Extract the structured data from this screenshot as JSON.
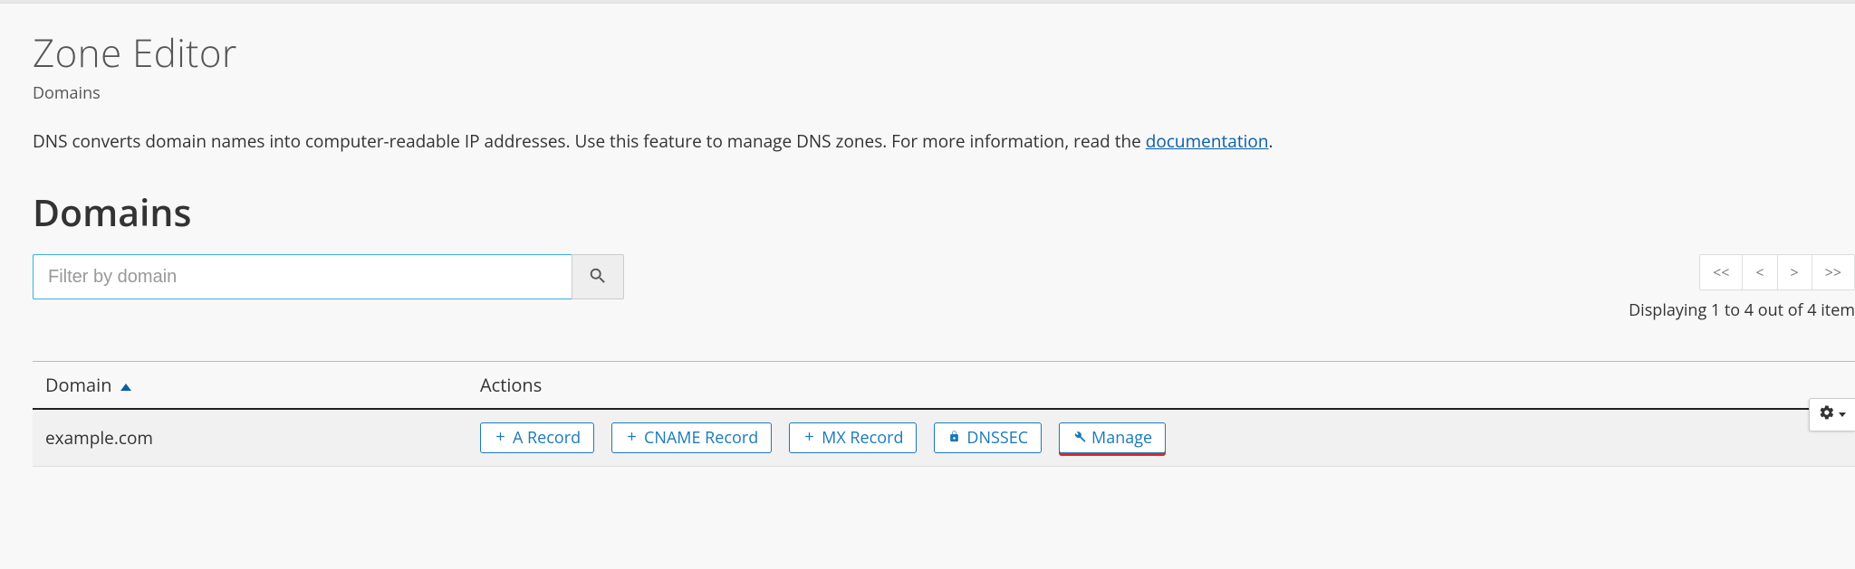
{
  "page": {
    "title": "Zone Editor",
    "subtitle": "Domains",
    "description_pre": "DNS converts domain names into computer-readable IP addresses. Use this feature to manage DNS zones. For more information, read the ",
    "doc_link_text": "documentation",
    "description_post": "."
  },
  "section": {
    "title": "Domains"
  },
  "search": {
    "placeholder": "Filter by domain"
  },
  "pager": {
    "first": "<<",
    "prev": "<",
    "next": ">",
    "last": ">>",
    "status": "Displaying 1 to 4 out of 4 item"
  },
  "table": {
    "columns": {
      "domain": "Domain",
      "actions": "Actions"
    },
    "rows": [
      {
        "domain": "example.com",
        "actions": {
          "a_record": "A Record",
          "cname_record": "CNAME Record",
          "mx_record": "MX Record",
          "dnssec": "DNSSEC",
          "manage": "Manage"
        }
      }
    ]
  }
}
